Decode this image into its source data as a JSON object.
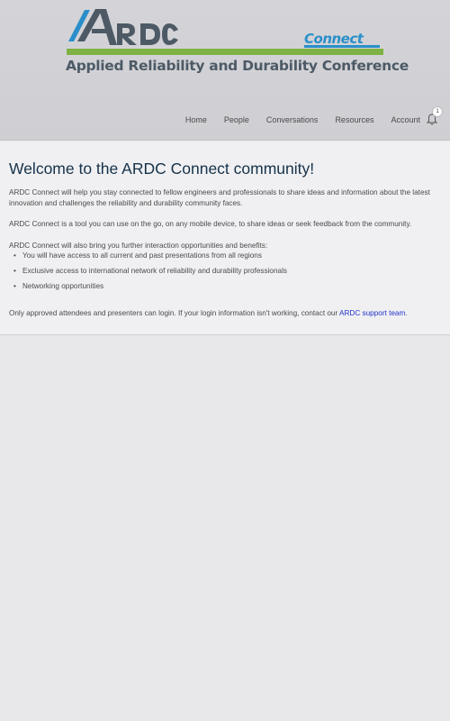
{
  "brand": {
    "logo_letters": "ARDC",
    "conference_name": "Applied Reliability and Durability Conference",
    "product_name": "Connect",
    "colors": {
      "dark": "#4d5a66",
      "green": "#7fb244",
      "blue": "#2a8fc9"
    }
  },
  "nav": {
    "items": [
      {
        "label": "Home"
      },
      {
        "label": "People"
      },
      {
        "label": "Conversations"
      },
      {
        "label": "Resources"
      },
      {
        "label": "Account"
      }
    ],
    "notifications": {
      "icon": "bell-icon",
      "count": "1"
    }
  },
  "main": {
    "heading": "Welcome to the ARDC Connect community!",
    "paragraph1": "ARDC Connect will help you stay connected to fellow engineers and professionals to share ideas and information about the latest innovation and challenges the reliability and durability community faces.",
    "paragraph2": "ARDC Connect is a tool you can use on the go, on any mobile device, to share ideas or seek feedback from the community.",
    "paragraph3": "ARDC Connect will also bring you further interaction opportunities and benefits:",
    "benefits": [
      "You will have access to all current and past presentations from all regions",
      "Exclusive access to international network of reliability and durability professionals",
      "Networking opportunities"
    ],
    "login_note": "Only approved attendees and presenters can login. If your login information isn't working, contact our",
    "support_link": "ARDC support team",
    "login_note_end": "."
  }
}
